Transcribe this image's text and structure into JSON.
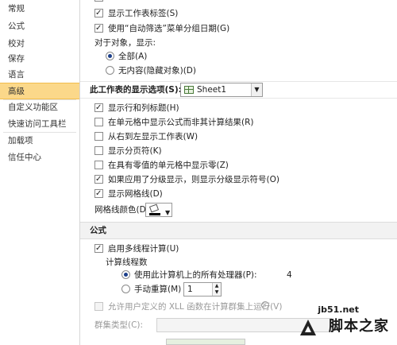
{
  "sidebar": {
    "items": [
      {
        "label": "常规"
      },
      {
        "label": "公式"
      },
      {
        "label": "校对"
      },
      {
        "label": "保存"
      },
      {
        "label": "语言"
      },
      {
        "label": "高级"
      },
      {
        "label": "自定义功能区"
      },
      {
        "label": "快速访问工具栏"
      },
      {
        "label": "加载项"
      },
      {
        "label": "信任中心"
      }
    ],
    "active": "高级"
  },
  "workbook_section": {
    "show_sheet_tabs": {
      "label": "显示工作表标签(S)",
      "checked": true
    },
    "autofilter_group_dates": {
      "label": "使用“自动筛选”菜单分组日期(G)",
      "checked": true
    },
    "for_objects_label": "对于对象，显示:",
    "show_all": {
      "label": "全部(A)",
      "selected": true
    },
    "show_nothing": {
      "label": "无内容(隐藏对象)(D)",
      "selected": false
    }
  },
  "sheet_section": {
    "title": "此工作表的显示选项(S):",
    "sheet_select": "Sheet1",
    "options": [
      {
        "label": "显示行和列标题(H)",
        "checked": true
      },
      {
        "label": "在单元格中显示公式而非其计算结果(R)",
        "checked": false
      },
      {
        "label": "从右到左显示工作表(W)",
        "checked": false
      },
      {
        "label": "显示分页符(K)",
        "checked": false
      },
      {
        "label": "在具有零值的单元格中显示零(Z)",
        "checked": false
      },
      {
        "label": "如果应用了分级显示，则显示分级显示符号(O)",
        "checked": true
      },
      {
        "label": "显示网格线(D)",
        "checked": true
      }
    ],
    "gridline_color_label": "网格线颜色(D)",
    "gridline_color": "#000000"
  },
  "formulas_section": {
    "title": "公式",
    "multithread": {
      "label": "启用多线程计算(U)",
      "checked": true
    },
    "threads_label": "计算线程数",
    "use_all": {
      "label": "使用此计算机上的所有处理器(P):",
      "value": "4",
      "selected": true
    },
    "manual": {
      "label": "手动重算(M)",
      "value": "1",
      "selected": false
    },
    "xll": {
      "label": "允许用户定义的 XLL 函数在计算群集上运行(V)",
      "checked": false
    },
    "cluster_type_label": "群集类型(C):"
  },
  "watermark": {
    "url": "jb51.net",
    "text": "脚本之家"
  }
}
